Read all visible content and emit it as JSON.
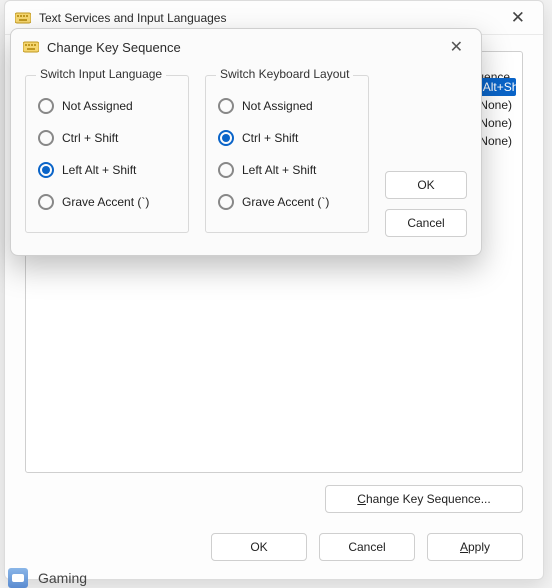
{
  "parent": {
    "title": "Text Services and Input Languages",
    "list_header": "Key Sequence",
    "list_rows": [
      {
        "text": "Left Alt+Shift",
        "selected": true
      },
      {
        "text": "(None)",
        "selected": false
      },
      {
        "text": "(None)",
        "selected": false
      },
      {
        "text": "(None)",
        "selected": false
      }
    ],
    "change_btn": "Change Key Sequence...",
    "ok": "OK",
    "cancel": "Cancel",
    "apply": "Apply"
  },
  "gaming": "Gaming",
  "modal": {
    "title": "Change Key Sequence",
    "group_input": {
      "title": "Switch Input Language",
      "options": [
        {
          "label": "Not Assigned",
          "checked": false
        },
        {
          "label": "Ctrl + Shift",
          "checked": false
        },
        {
          "label": "Left Alt + Shift",
          "checked": true
        },
        {
          "label": "Grave Accent (`)",
          "checked": false
        }
      ]
    },
    "group_layout": {
      "title": "Switch Keyboard Layout",
      "options": [
        {
          "label": "Not Assigned",
          "checked": false
        },
        {
          "label": "Ctrl + Shift",
          "checked": true
        },
        {
          "label": "Left Alt + Shift",
          "checked": false
        },
        {
          "label": "Grave Accent (`)",
          "checked": false
        }
      ]
    },
    "ok": "OK",
    "cancel": "Cancel"
  }
}
